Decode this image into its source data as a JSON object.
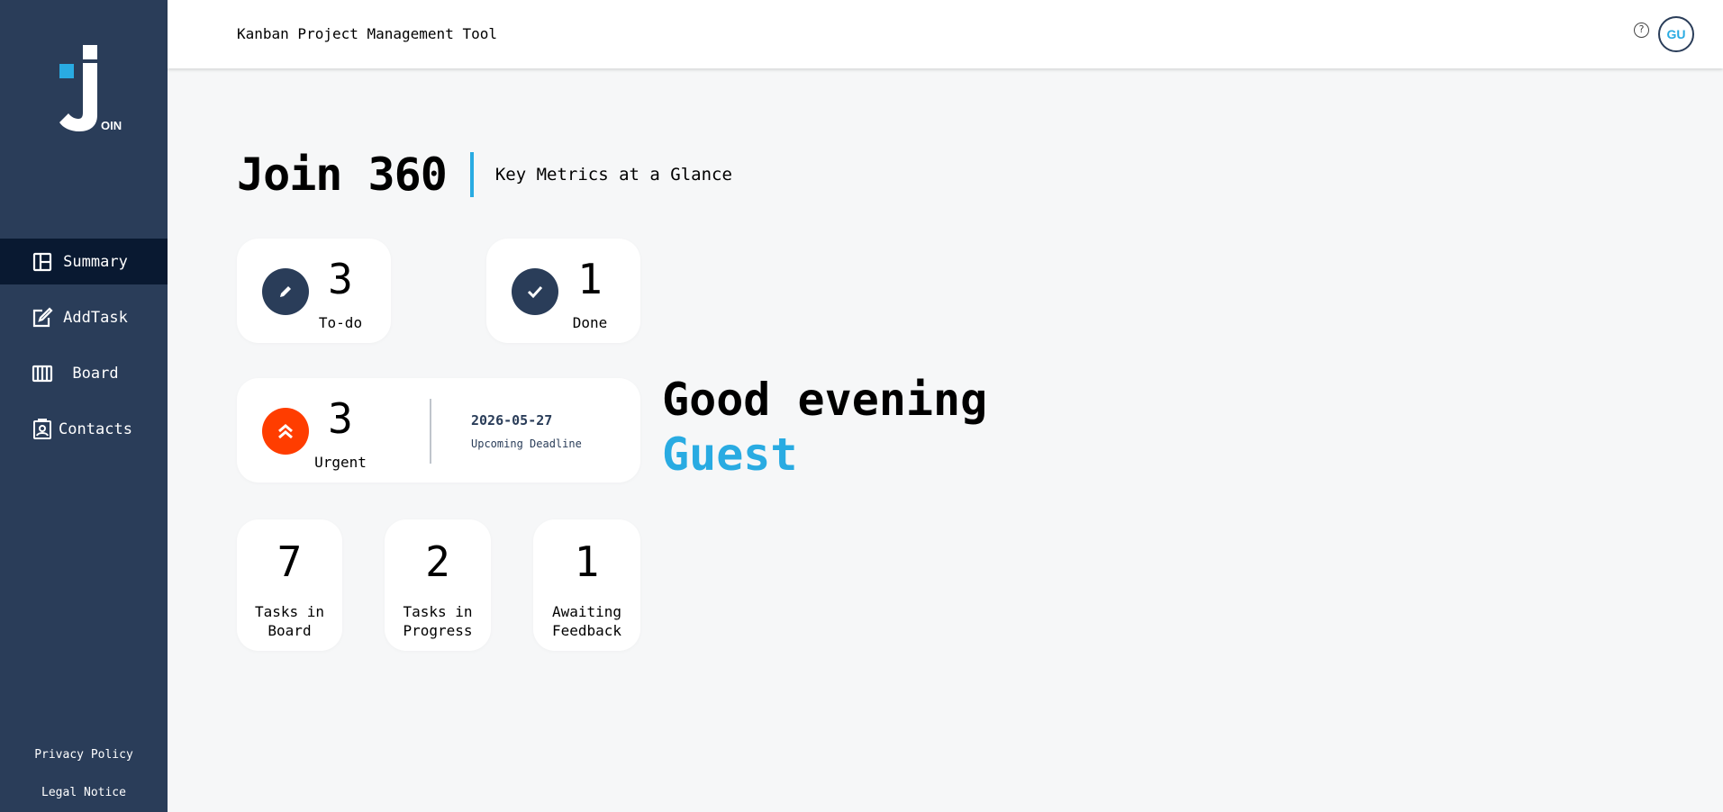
{
  "app": {
    "title": "Kanban Project Management Tool",
    "logo_text": "OIN",
    "accent_color": "#29abe2",
    "sidebar_color": "#2a3d59"
  },
  "sidebar": {
    "items": [
      {
        "label": "Summary",
        "icon": "summary-icon",
        "active": true
      },
      {
        "label": "AddTask",
        "icon": "add-task-icon",
        "active": false
      },
      {
        "label": "Board",
        "icon": "board-icon",
        "active": false
      },
      {
        "label": "Contacts",
        "icon": "contacts-icon",
        "active": false
      }
    ],
    "footer": {
      "privacy": "Privacy Policy",
      "legal": "Legal Notice"
    }
  },
  "header": {
    "help_icon": "?",
    "avatar_initials": "GU"
  },
  "main": {
    "title": "Join 360",
    "subtitle": "Key Metrics at a Glance",
    "todo": {
      "count": "3",
      "label": "To-do"
    },
    "done": {
      "count": "1",
      "label": "Done"
    },
    "urgent": {
      "count": "3",
      "label": "Urgent",
      "color": "#ff3d00"
    },
    "deadline": {
      "date": "2026-05-27",
      "label": "Upcoming Deadline"
    },
    "tasks_in_board": {
      "count": "7",
      "label_line1": "Tasks in",
      "label_line2": "Board"
    },
    "tasks_in_progress": {
      "count": "2",
      "label_line1": "Tasks in",
      "label_line2": "Progress"
    },
    "awaiting_feedback": {
      "count": "1",
      "label_line1": "Awaiting",
      "label_line2": "Feedback"
    },
    "greeting": "Good evening",
    "user_name": "Guest"
  }
}
